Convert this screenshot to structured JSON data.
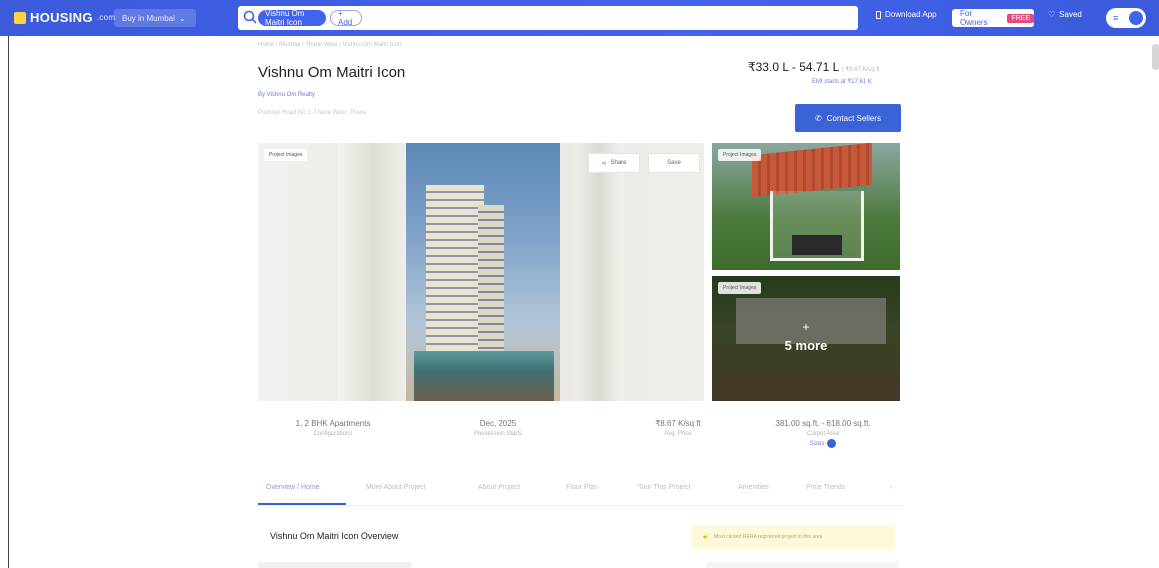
{
  "header": {
    "logo": "HOUSING",
    "logo_suffix": ".com",
    "city": "Buy in Mumbai",
    "search_chip": "Vishnu Om Maitri Icon",
    "add_chip": "+ Add",
    "download_app": "Download App",
    "owners_label": "For Owners",
    "owners_badge": "FREE",
    "saved": "Saved",
    "menu_glyph": "≡"
  },
  "project": {
    "breadcrumb": "Home / Mumbai / Thane West / Vishnu Om Maitri Icon",
    "title": "Vishnu Om Maitri Icon",
    "byline": "By Vishnu Om Realty",
    "address": "Pokhran Road No 2, Thane West, Thane",
    "price": "₹33.0 L - 54.71 L",
    "price_per_sqft": "| ₹8.67 K/sq ft",
    "emi": "EMI starts at ₹17.61 K",
    "contact_button": "Contact Sellers"
  },
  "gallery": {
    "main_tag": "Project Images",
    "side_top_tag": "Project Images",
    "side_bottom_tag": "Project Images",
    "share": "Share",
    "save": "Save",
    "more_plus": "+",
    "more": "5 more"
  },
  "stats": [
    {
      "value": "1, 2 BHK Apartments",
      "label": "Configurations"
    },
    {
      "value": "Dec, 2025",
      "label": "Possession Starts"
    },
    {
      "value": "₹8.67 K/sq ft",
      "label": "Avg. Price"
    },
    {
      "value": "381.00 sq.ft. - 618.00 sq.ft.",
      "label": "Carpet Area",
      "extra": "Sizes"
    }
  ],
  "tabs": [
    "Overview / Home",
    "More About Project",
    "About Project",
    "Floor Plan",
    "Tour This Project",
    "Amenities",
    "Price Trends"
  ],
  "tabs_more": "›",
  "overview": {
    "title": "Vishnu Om Maitri Icon Overview",
    "notice": "Most clicked RERA registered project in this area"
  },
  "colors": {
    "brand": "#3b5bdb",
    "accent": "#3b63d8",
    "notice_bg": "#fff9db"
  }
}
